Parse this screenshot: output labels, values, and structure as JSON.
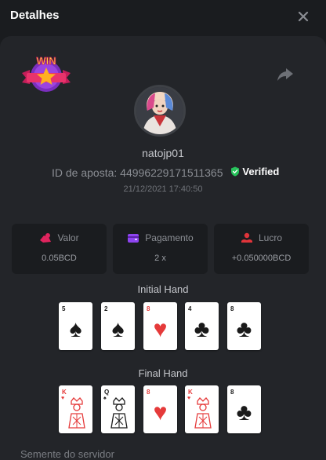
{
  "header": {
    "title": "Detalhes"
  },
  "icons": {
    "close": "close-icon",
    "share": "share-icon",
    "badge": "win-badge-icon",
    "verified": "shield-check-icon"
  },
  "badge": {
    "text": "WIN"
  },
  "user": {
    "name": "natojp01"
  },
  "bet": {
    "id_label": "ID de aposta:",
    "id_value": "44996229171511365",
    "verified": "Verified",
    "date": "21/12/2021 17:40:50"
  },
  "stats": [
    {
      "label": "Valor",
      "value": "0.05BCD",
      "icon": "coins-icon",
      "color": "#e0245e"
    },
    {
      "label": "Pagamento",
      "value": "2 x",
      "icon": "wallet-icon",
      "color": "#8e44f0"
    },
    {
      "label": "Lucro",
      "value": "+0.050000BCD",
      "icon": "profit-icon",
      "color": "#e0343a"
    }
  ],
  "initial_hand": {
    "label": "Initial Hand",
    "cards": [
      {
        "rank": "5",
        "suit": "♠",
        "color": "black"
      },
      {
        "rank": "2",
        "suit": "♠",
        "color": "black"
      },
      {
        "rank": "8",
        "suit": "♥",
        "color": "red"
      },
      {
        "rank": "4",
        "suit": "♣",
        "color": "black"
      },
      {
        "rank": "8",
        "suit": "♣",
        "color": "black"
      }
    ]
  },
  "final_hand": {
    "label": "Final Hand",
    "cards": [
      {
        "rank": "K",
        "suit": "♥",
        "color": "red",
        "face": true
      },
      {
        "rank": "Q",
        "suit": "♠",
        "color": "black",
        "face": true
      },
      {
        "rank": "8",
        "suit": "♥",
        "color": "red"
      },
      {
        "rank": "K",
        "suit": "♥",
        "color": "red",
        "face": true
      },
      {
        "rank": "8",
        "suit": "♣",
        "color": "black"
      }
    ]
  },
  "seed": {
    "label": "Semente do servidor"
  },
  "colors": {
    "verified": "#27c25b",
    "panel": "#232529",
    "background": "#1a1c1f"
  }
}
